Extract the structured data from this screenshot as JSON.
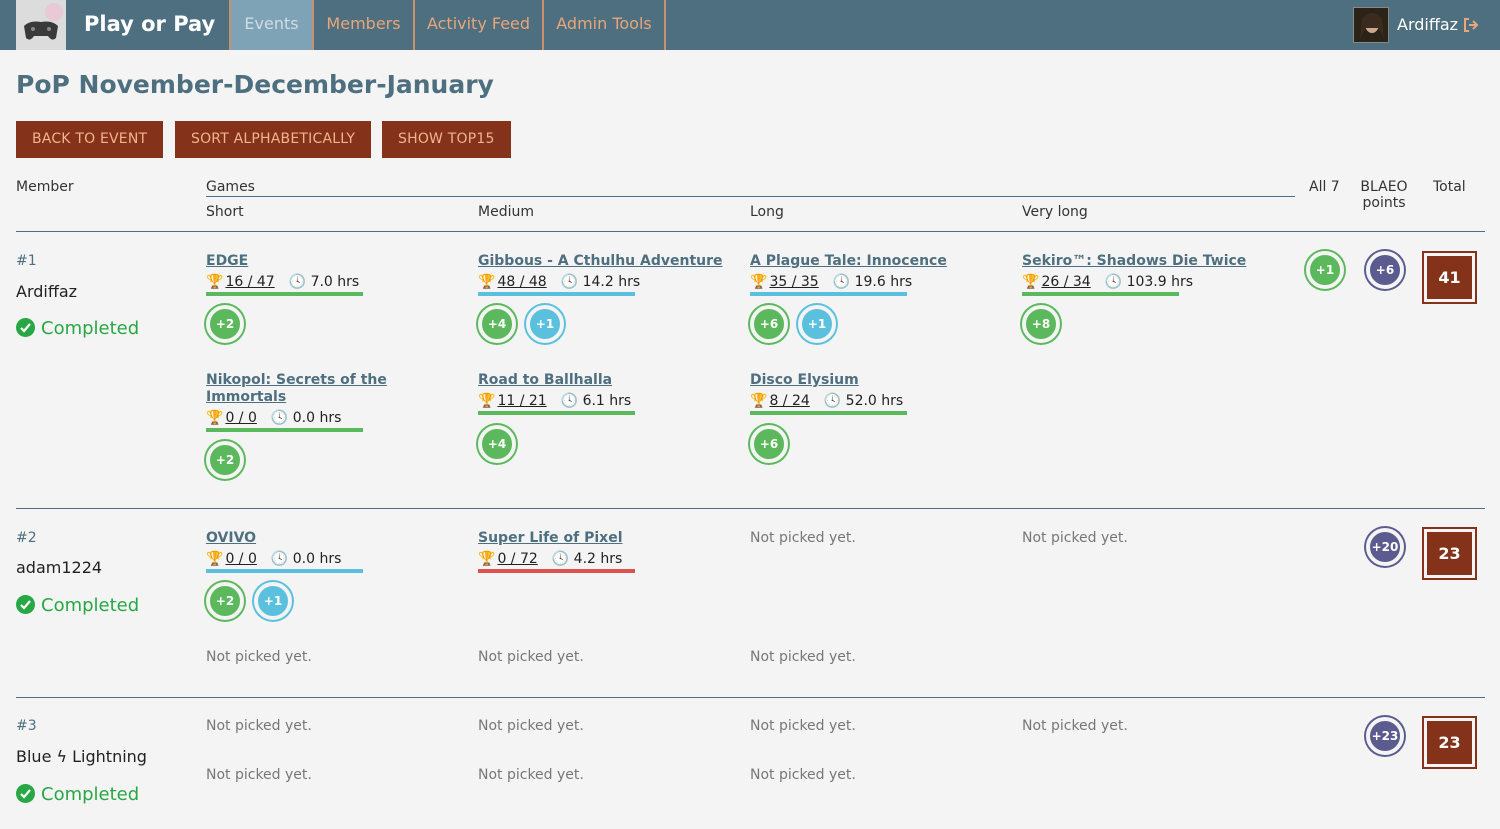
{
  "nav": {
    "brand": "Play or Pay",
    "tabs": [
      "Events",
      "Members",
      "Activity Feed",
      "Admin Tools"
    ],
    "username": "Ardiffaz"
  },
  "page": {
    "title": "PoP November-December-January",
    "buttons": [
      "BACK TO EVENT",
      "SORT ALPHABETICALLY",
      "SHOW TOP15"
    ]
  },
  "headers": {
    "member": "Member",
    "games": "Games",
    "short": "Short",
    "medium": "Medium",
    "long": "Long",
    "very_long": "Very long",
    "all7": "All 7",
    "blaeo_1": "BLAEO",
    "blaeo_2": "points",
    "total": "Total"
  },
  "not_picked": "Not picked yet.",
  "members": [
    {
      "rank": "#1",
      "name": "Ardiffaz",
      "status": "Completed",
      "all7": "+1",
      "blaeo": "+6",
      "total": "41",
      "games": [
        {
          "title": "EDGE",
          "ach": "16 / 47",
          "hrs": "7.0 hrs",
          "bar": "#5cb85c",
          "badges": [
            {
              "t": "+2",
              "c": "green"
            }
          ]
        },
        {
          "title": "Gibbous - A Cthulhu Adventure",
          "ach": "48 / 48",
          "hrs": "14.2 hrs",
          "bar": "#5bc0de",
          "badges": [
            {
              "t": "+4",
              "c": "green"
            },
            {
              "t": "+1",
              "c": "blue"
            }
          ]
        },
        {
          "title": "A Plague Tale: Innocence",
          "ach": "35 / 35",
          "hrs": "19.6 hrs",
          "bar": "#5bc0de",
          "badges": [
            {
              "t": "+6",
              "c": "green"
            },
            {
              "t": "+1",
              "c": "blue"
            }
          ]
        },
        {
          "title": "Sekiro™: Shadows Die Twice",
          "ach": "26 / 34",
          "hrs": "103.9 hrs",
          "bar": "#5cb85c",
          "badges": [
            {
              "t": "+8",
              "c": "green"
            }
          ]
        },
        {
          "title": "Nikopol: Secrets of the Immortals",
          "ach": "0 / 0",
          "hrs": "0.0 hrs",
          "bar": "#5cb85c",
          "badges": [
            {
              "t": "+2",
              "c": "green"
            }
          ]
        },
        {
          "title": "Road to Ballhalla",
          "ach": "11 / 21",
          "hrs": "6.1 hrs",
          "bar": "#5cb85c",
          "badges": [
            {
              "t": "+4",
              "c": "green"
            }
          ]
        },
        {
          "title": "Disco Elysium",
          "ach": "8 / 24",
          "hrs": "52.0 hrs",
          "bar": "#5cb85c",
          "badges": [
            {
              "t": "+6",
              "c": "green"
            }
          ]
        }
      ]
    },
    {
      "rank": "#2",
      "name": "adam1224",
      "status": "Completed",
      "blaeo": "+20",
      "total": "23",
      "games": [
        {
          "title": "OVIVO",
          "ach": "0 / 0",
          "hrs": "0.0 hrs",
          "bar": "#5bc0de",
          "badges": [
            {
              "t": "+2",
              "c": "green"
            },
            {
              "t": "+1",
              "c": "blue"
            }
          ]
        },
        {
          "title": "Super Life of Pixel",
          "ach": "0 / 72",
          "hrs": "4.2 hrs",
          "bar": "#d9534f",
          "badges": []
        }
      ]
    },
    {
      "rank": "#3",
      "name": "Blue ϟ Lightning",
      "status": "Completed",
      "blaeo": "+23",
      "total": "23",
      "games": []
    }
  ]
}
